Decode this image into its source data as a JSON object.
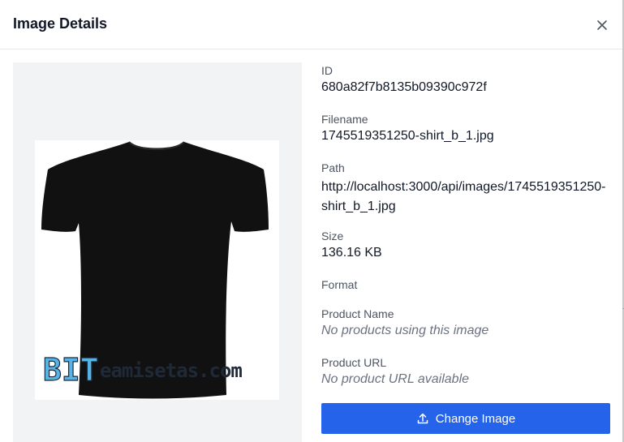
{
  "dialog": {
    "title": "Image Details"
  },
  "details": {
    "id": {
      "label": "ID",
      "value": "680a82f7b8135b09390c972f"
    },
    "filename": {
      "label": "Filename",
      "value": "1745519351250-shirt_b_1.jpg"
    },
    "path": {
      "label": "Path",
      "value": "http://localhost:3000/api/images/1745519351250-shirt_b_1.jpg"
    },
    "size": {
      "label": "Size",
      "value": "136.16 KB"
    },
    "format": {
      "label": "Format",
      "value": ""
    },
    "product_name": {
      "label": "Product Name",
      "value": "No products using this image"
    },
    "product_url": {
      "label": "Product URL",
      "value": "No product URL available"
    }
  },
  "image": {
    "watermark_bit": "BIT",
    "watermark_rest": "eamisetas.com"
  },
  "actions": {
    "change_image_label": "Change Image"
  },
  "icons": {
    "close": "close-icon",
    "upload": "upload-icon"
  },
  "colors": {
    "primary": "#2563eb",
    "preview_bg": "#f2f3f5",
    "shirt": "#111111"
  }
}
